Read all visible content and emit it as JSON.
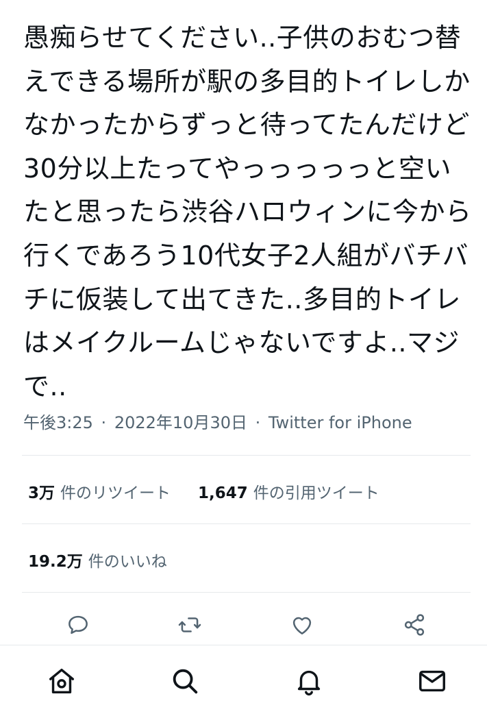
{
  "tweet": {
    "text": "愚痴らせてください..子供のおむつ替えできる場所が駅の多目的トイレしかなかったからずっと待ってたんだけど30分以上たってやっっっっっと空いたと思ったら渋谷ハロウィンに今から行くであろう10代女子2人組がバチバチに仮装して出てきた..多目的トイレはメイクルームじゃないですよ..マジで..",
    "time": "午後3:25",
    "date": "2022年10月30日",
    "source": "Twitter for iPhone",
    "separator": "·"
  },
  "stats": {
    "retweets_count": "3万",
    "retweets_label": "件のリツイート",
    "quotes_count": "1,647",
    "quotes_label": "件の引用ツイート",
    "likes_count": "19.2万",
    "likes_label": "件のいいね"
  },
  "actions": {
    "icons": [
      "reply-icon",
      "retweet-icon",
      "like-icon",
      "share-icon"
    ]
  },
  "bottom_nav": {
    "icons": [
      "home-icon",
      "search-icon",
      "notifications-icon",
      "messages-icon"
    ]
  },
  "colors": {
    "text": "#0f1419",
    "secondary": "#536471",
    "divider": "#e6e9eb"
  }
}
